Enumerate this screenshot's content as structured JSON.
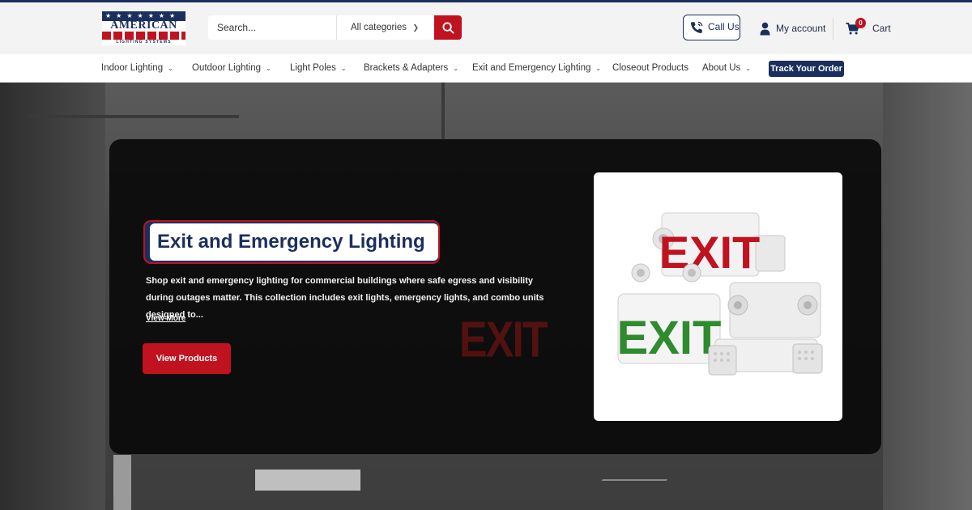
{
  "brand": {
    "logo_stars": "★★★★★★★",
    "logo_word": "AMERICAN",
    "logo_tagline": "LIGHTING SYSTEMS"
  },
  "search": {
    "placeholder": "Search...",
    "category": "All categories"
  },
  "header_actions": {
    "call": "Call Us",
    "account": "My account",
    "cart": "Cart",
    "cart_count": "0"
  },
  "nav": {
    "items": [
      {
        "label": "Indoor Lighting",
        "dropdown": true
      },
      {
        "label": "Outdoor Lighting",
        "dropdown": true
      },
      {
        "label": "Light Poles",
        "dropdown": true
      },
      {
        "label": "Brackets & Adapters",
        "dropdown": true
      },
      {
        "label": "Exit and Emergency Lighting",
        "dropdown": true
      },
      {
        "label": "Closeout Products",
        "dropdown": false
      },
      {
        "label": "About Us",
        "dropdown": true
      }
    ],
    "track_order": "Track Your Order"
  },
  "hero": {
    "title": "Exit and Emergency Lighting",
    "description": "Shop exit and emergency lighting for commercial buildings where safe egress and visibility during outages matter. This collection includes exit lights, emergency lights, and combo units designed to...",
    "view_more": "View More",
    "cta": "View Products",
    "background_sign": "EXIT",
    "product_sign_red": "EXIT",
    "product_sign_green": "EXIT"
  },
  "colors": {
    "navy": "#1b2f5e",
    "red": "#c1121f",
    "green_sign": "#2e8b2e"
  }
}
